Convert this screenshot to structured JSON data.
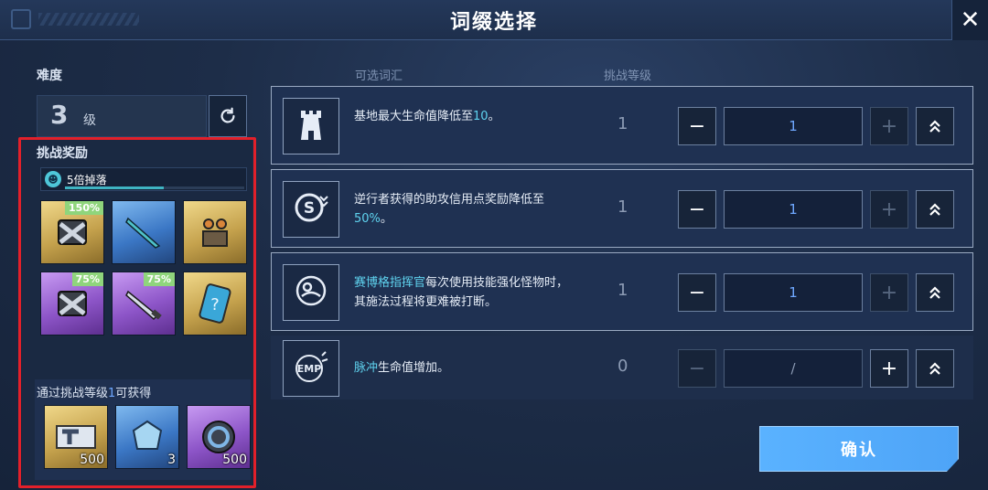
{
  "header": {
    "title": "词缀选择",
    "close_icon": "close-icon"
  },
  "left": {
    "difficulty_label": "难度",
    "difficulty_value": "3",
    "difficulty_unit": "级",
    "rewards_label": "挑战奖励",
    "drop_label": "5倍掉落",
    "drop_progress": 0.55,
    "items": [
      {
        "rarity": "gold",
        "badge": "150%",
        "icon": "armor-crate-icon"
      },
      {
        "rarity": "blue",
        "badge": "",
        "icon": "blade-icon"
      },
      {
        "rarity": "gold",
        "badge": "",
        "icon": "module-icon"
      },
      {
        "rarity": "purple",
        "badge": "75%",
        "icon": "armor-crate-icon"
      },
      {
        "rarity": "purple",
        "badge": "75%",
        "icon": "knife-icon"
      },
      {
        "rarity": "gold",
        "badge": "",
        "icon": "mystery-card-icon"
      }
    ],
    "clear_reward_prefix": "通过挑战等级",
    "clear_reward_level": "1",
    "clear_reward_suffix": "可获得",
    "clear_items": [
      {
        "rarity": "gold",
        "count": "500",
        "icon": "ticket-icon"
      },
      {
        "rarity": "blue",
        "count": "3",
        "icon": "crystal-icon"
      },
      {
        "rarity": "purple",
        "count": "500",
        "icon": "ring-coin-icon"
      }
    ]
  },
  "columns": {
    "words": "可选词汇",
    "level": "挑战等级"
  },
  "affixes": [
    {
      "icon": "tower-icon",
      "text_pre": "基地最大生命值降低至",
      "text_hl": "",
      "text_num": "10",
      "text_post": "。",
      "level": "1",
      "value": "1"
    },
    {
      "icon": "credit-icon",
      "text_pre": "逆行者获得的助攻信用点奖励降低至",
      "text_hl": "",
      "text_num": "50%",
      "text_post": "。",
      "level": "1",
      "value": "1"
    },
    {
      "icon": "cyborg-icon",
      "text_pre": "",
      "text_hl": "赛博格指挥官",
      "text_num": "",
      "text_post": "每次使用技能强化怪物时，其施法过程将更难被打断。",
      "level": "1",
      "value": "1"
    },
    {
      "icon": "emp-icon",
      "text_pre": "",
      "text_hl": "脉冲",
      "text_num": "",
      "text_post": "生命值增加。",
      "level": "0",
      "value": "/"
    }
  ],
  "confirm_label": "确认",
  "colors": {
    "accent": "#4ea4f7",
    "highlight": "#5fd3ef",
    "alert": "#e2202a"
  }
}
